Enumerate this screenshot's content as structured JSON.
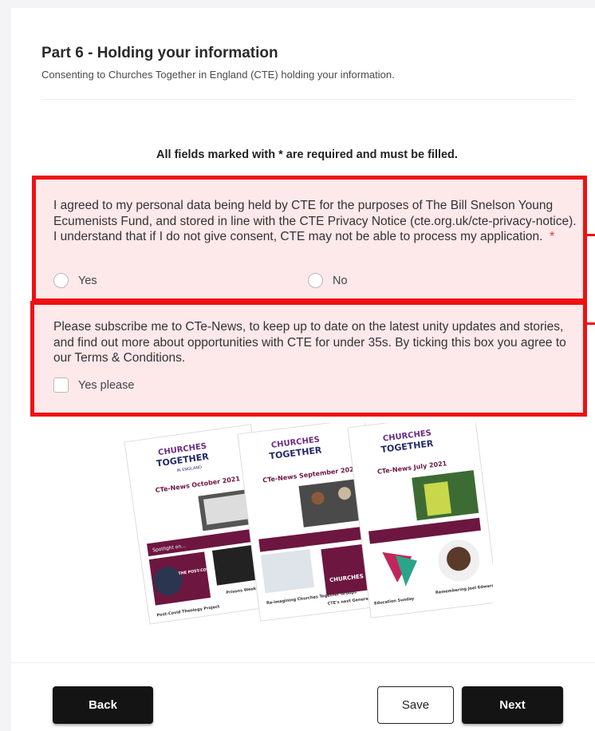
{
  "header": {
    "title": "Part 6 - Holding your information",
    "subtitle": "Consenting to Churches Together in England (CTE) holding your information."
  },
  "required_note": "All fields marked with * are required and must be filled.",
  "consent": {
    "text": "I agreed to my personal data being held by CTE for the purposes of The Bill Snelson Young Ecumenists Fund, and stored in line with the CTE Privacy Notice (cte.org.uk/cte-privacy-notice). I understand that if I do not give consent, CTE may not be able to process my application.",
    "required_mark": "*",
    "options": [
      "Yes",
      "No"
    ]
  },
  "subscribe": {
    "text": "Please subscribe me to CTe-News, to keep up to date on the latest unity updates and stories, and find out more about opportunities with CTE for under 35s. By ticking this box you agree to our Terms & Conditions.",
    "checkbox_label": "Yes please"
  },
  "newsletter_image": {
    "logo_line1": "CHURCHES",
    "logo_line2": "TOGETHER",
    "logo_line3": "IN ENGLAND",
    "issues": [
      "CTe-News October 2021",
      "CTe-News September 2021",
      "CTe-News July 2021"
    ],
    "spotlight": "Spotlight on...",
    "project_title": "THE POST-COVID THEOLOGY PROJECT",
    "captions": [
      "Post-Covid Theology Project",
      "Prisons Week",
      "Re-imagining Churches Together Groups",
      "CTE's next General Secretary",
      "Education Sunday",
      "Remembering Joel Edwards"
    ],
    "colors": {
      "maroon": "#6d1640",
      "navy": "#252a64",
      "purple": "#6b2c86"
    }
  },
  "footer": {
    "back_label": "Back",
    "save_label": "Save",
    "next_label": "Next"
  },
  "colors": {
    "highlight_border": "#ee1111",
    "highlight_fill": "#fde8ea",
    "button_dark": "#141414"
  }
}
